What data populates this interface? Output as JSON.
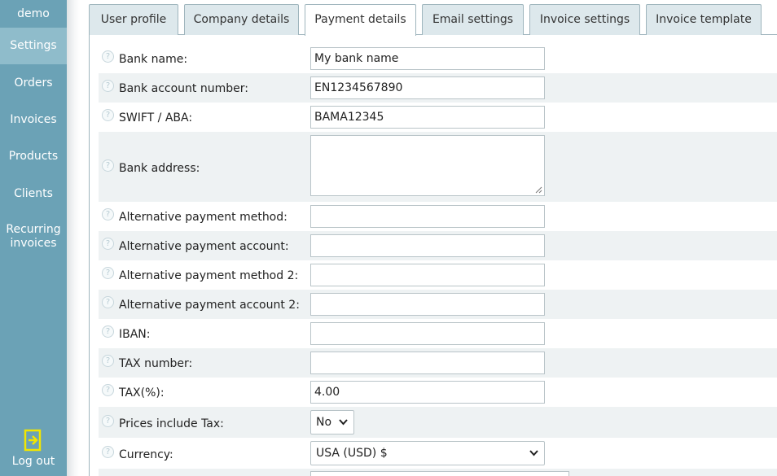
{
  "sidebar": {
    "user": "demo",
    "items": [
      {
        "label": "Settings",
        "active": true
      },
      {
        "label": "Orders"
      },
      {
        "label": "Invoices"
      },
      {
        "label": "Products"
      },
      {
        "label": "Clients"
      },
      {
        "label": "Recurring invoices"
      }
    ],
    "logout_label": "Log out",
    "logout_icon": "logout-icon",
    "color": "#6ba2b6",
    "active_color": "#8fbccb",
    "logout_icon_color": "#f2e600"
  },
  "tabs": [
    {
      "label": "User profile"
    },
    {
      "label": "Company details"
    },
    {
      "label": "Payment details",
      "active": true
    },
    {
      "label": "Email settings"
    },
    {
      "label": "Invoice settings"
    },
    {
      "label": "Invoice template"
    }
  ],
  "form": {
    "help_icon": "question-icon",
    "fields": [
      {
        "label": "Bank name:",
        "value": "My bank name"
      },
      {
        "label": "Bank account number:",
        "value": "EN1234567890"
      },
      {
        "label": "SWIFT / ABA:",
        "value": "BAMA12345"
      },
      {
        "label": "Bank address:",
        "value": ""
      },
      {
        "label": "Alternative payment method:",
        "value": ""
      },
      {
        "label": "Alternative payment account:",
        "value": ""
      },
      {
        "label": "Alternative payment method 2:",
        "value": ""
      },
      {
        "label": "Alternative payment account 2:",
        "value": ""
      },
      {
        "label": "IBAN:",
        "value": ""
      },
      {
        "label": "TAX number:",
        "value": ""
      },
      {
        "label": "TAX(%):",
        "value": "4.00"
      },
      {
        "label": "Prices include Tax:",
        "value": "No"
      },
      {
        "label": "Currency:",
        "value": "USA (USD) $"
      }
    ]
  }
}
